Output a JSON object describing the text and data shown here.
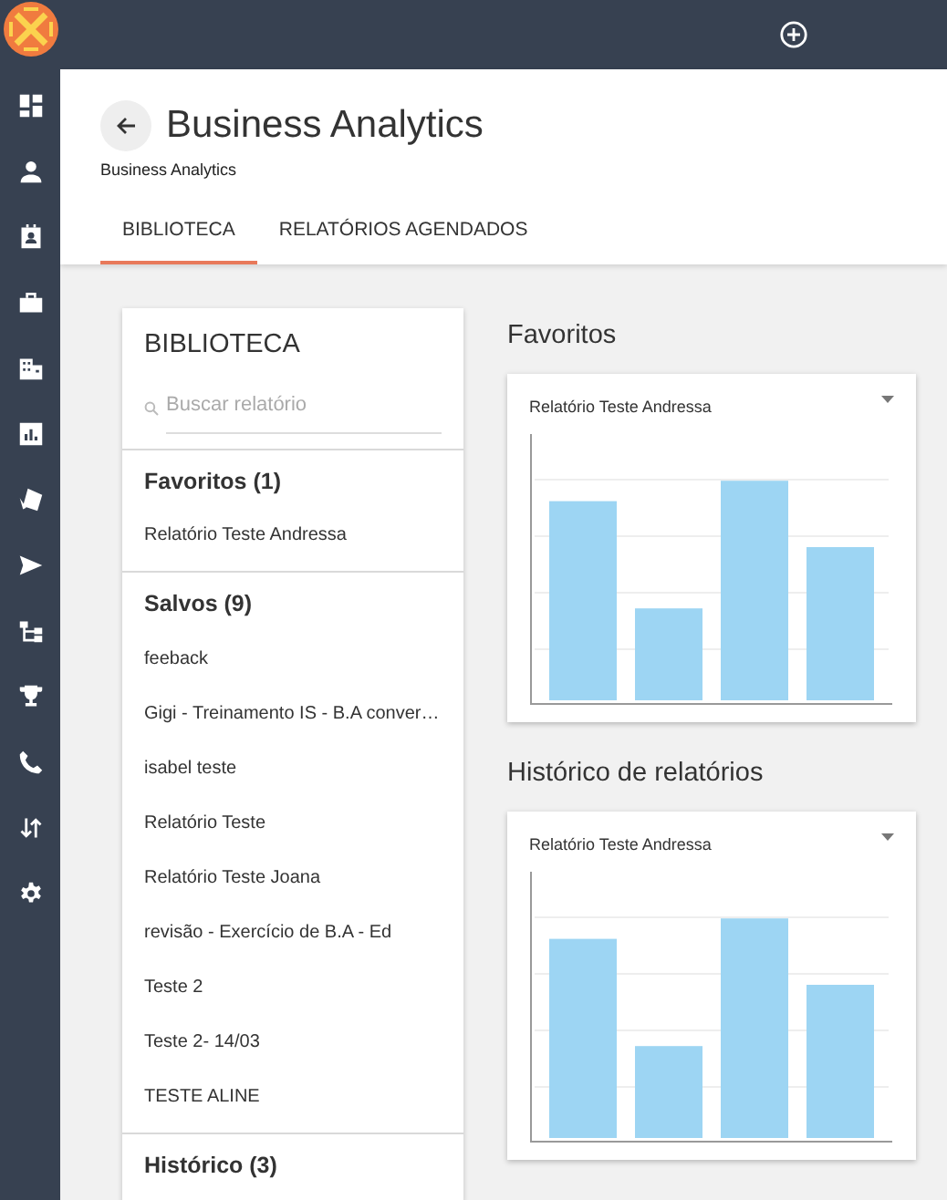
{
  "header": {
    "title": "Business Analytics",
    "breadcrumb": "Business Analytics"
  },
  "tabs": [
    {
      "label": "BIBLIOTECA",
      "selected": true
    },
    {
      "label": "RELATÓRIOS AGENDADOS",
      "selected": false
    }
  ],
  "library": {
    "title": "BIBLIOTECA",
    "search": {
      "placeholder": "Buscar relatório"
    },
    "sections": [
      {
        "heading": "Favoritos (1)",
        "items": [
          "Relatório Teste Andressa"
        ]
      },
      {
        "heading": "Salvos (9)",
        "items": [
          "feeback",
          "Gigi - Treinamento IS - B.A conver…",
          "isabel teste",
          "Relatório Teste",
          "Relatório Teste Joana",
          "revisão - Exercício de B.A - Ed",
          "Teste 2",
          "Teste 2- 14/03",
          "TESTE ALINE"
        ]
      },
      {
        "heading": "Histórico (3)"
      }
    ]
  },
  "panels": [
    {
      "heading": "Favoritos",
      "report": "Relatório Teste Andressa",
      "kind": "picture"
    },
    {
      "heading": "Histórico de relatórios",
      "report": "Relatório Teste Andressa",
      "kind": "picture"
    }
  ]
}
